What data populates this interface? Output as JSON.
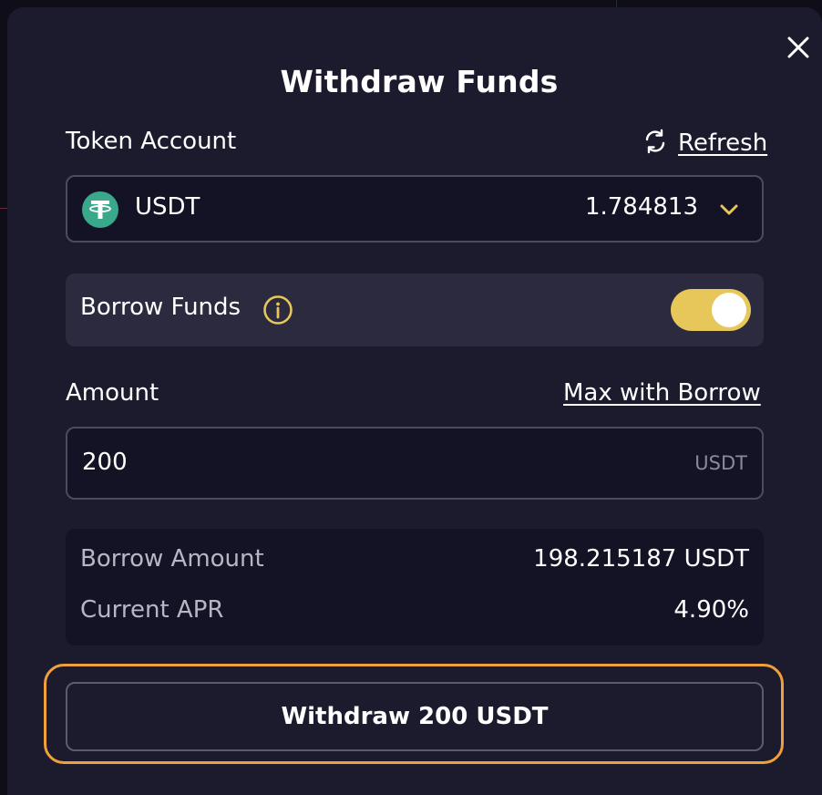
{
  "modal": {
    "title": "Withdraw Funds",
    "close_icon": "close-icon"
  },
  "token_account": {
    "label": "Token Account",
    "refresh_label": "Refresh",
    "refresh_icon": "refresh-icon",
    "selected_token": "USDT",
    "token_icon": "tether-icon",
    "balance": "1.784813",
    "dropdown_icon": "chevron-down-icon"
  },
  "borrow": {
    "label": "Borrow Funds",
    "info_icon": "info-icon",
    "enabled": true
  },
  "amount": {
    "label": "Amount",
    "max_link": "Max with Borrow",
    "value": "200",
    "unit": "USDT"
  },
  "summary": {
    "borrow_amount_label": "Borrow Amount",
    "borrow_amount_value": "198.215187 USDT",
    "apr_label": "Current APR",
    "apr_value": "4.90%"
  },
  "actions": {
    "withdraw_label": "Withdraw 200 USDT"
  },
  "colors": {
    "accent_yellow": "#e8c75a",
    "focus_orange": "#f0a03a",
    "modal_bg": "#1c1b2e",
    "tether_green": "#3aa88a"
  }
}
